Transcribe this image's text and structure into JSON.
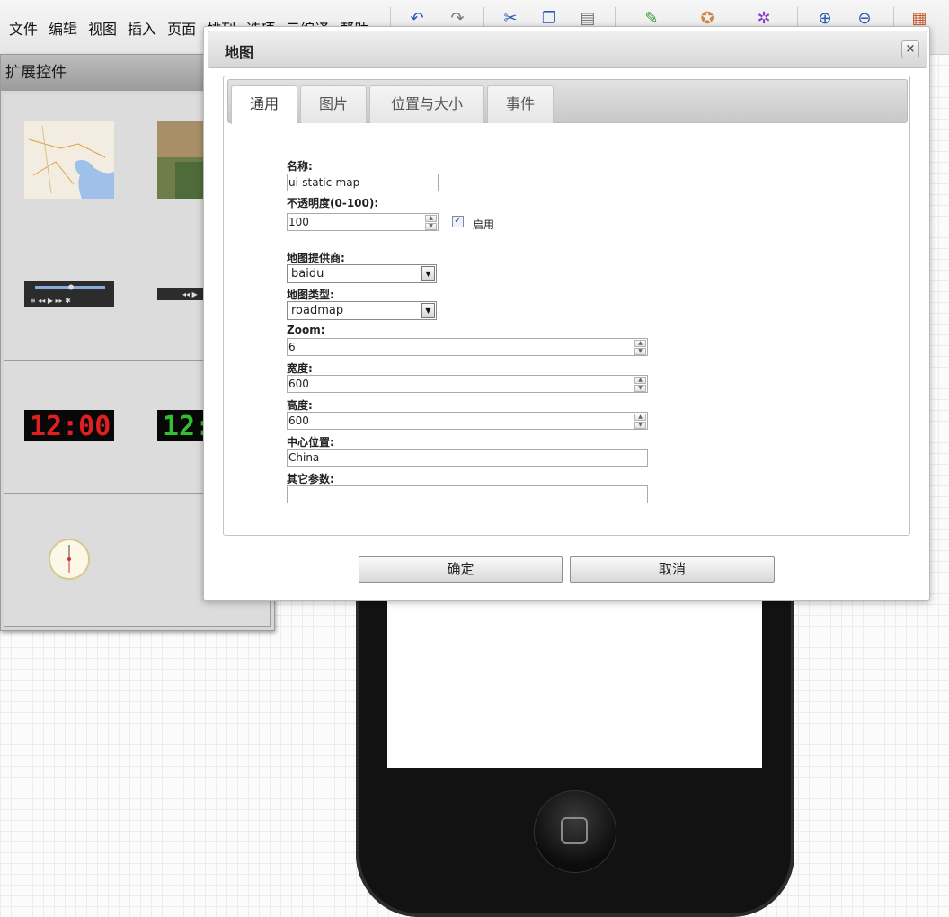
{
  "menubar": {
    "items": [
      "文件",
      "编辑",
      "视图",
      "插入",
      "页面",
      "排列",
      "选项",
      "云编译",
      "帮助"
    ]
  },
  "ext_panel": {
    "title": "扩展控件",
    "items": [
      {
        "name": "static-map-thumbnail"
      },
      {
        "name": "satellite-map-thumbnail"
      },
      {
        "name": "media-player-thumbnail"
      },
      {
        "name": "mini-player-thumbnail"
      },
      {
        "name": "digital-clock-red-thumbnail"
      },
      {
        "name": "digital-clock-green-thumbnail"
      },
      {
        "name": "analog-clock-thumbnail"
      },
      {
        "name": "analog-clock-2-thumbnail"
      }
    ]
  },
  "dialog": {
    "title": "地图",
    "close": "×",
    "tabs": [
      {
        "label": "通用",
        "active": true
      },
      {
        "label": "图片",
        "active": false
      },
      {
        "label": "位置与大小",
        "active": false
      },
      {
        "label": "事件",
        "active": false
      }
    ],
    "form": {
      "name_label": "名称:",
      "name_value": "ui-static-map",
      "opacity_label": "不透明度(0-100):",
      "opacity_value": "100",
      "enable_label": "启用",
      "enable_checked": true,
      "provider_label": "地图提供商:",
      "provider_value": "baidu",
      "maptype_label": "地图类型:",
      "maptype_value": "roadmap",
      "zoom_label": "Zoom:",
      "zoom_value": "6",
      "width_label": "宽度:",
      "width_value": "600",
      "height_label": "高度:",
      "height_value": "600",
      "center_label": "中心位置:",
      "center_value": "China",
      "other_label": "其它参数:",
      "other_value": ""
    },
    "ok_label": "确定",
    "cancel_label": "取消"
  },
  "colors": {
    "accent_blue": "#2a5bb8",
    "digital_red": "#e02020",
    "digital_green": "#30c030"
  }
}
